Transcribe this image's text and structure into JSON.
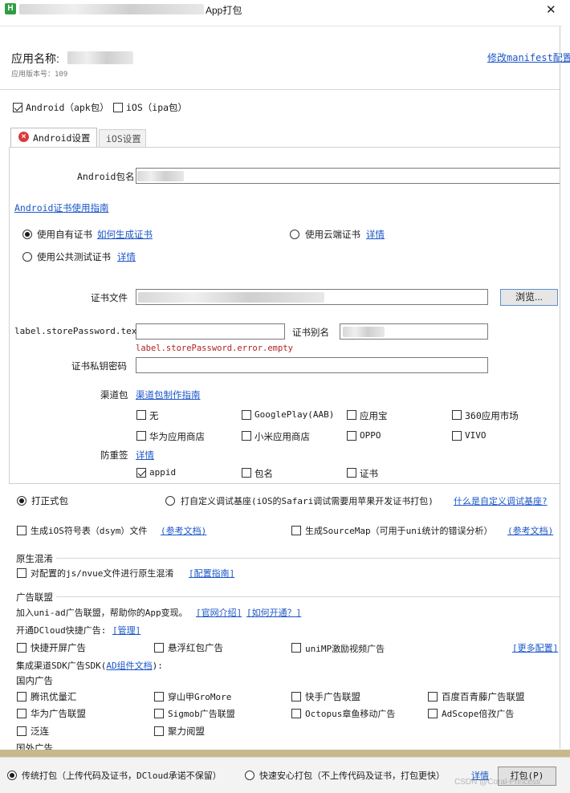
{
  "window": {
    "title": "App打包",
    "close_glyph": "✕",
    "logo_text": "H"
  },
  "header": {
    "app_name_label": "应用名称:",
    "app_version": "应用版本号：109",
    "manifest_link": "修改manifest配置"
  },
  "platforms": {
    "android": {
      "label": "Android（apk包）",
      "checked": true
    },
    "ios": {
      "label": "iOS（ipa包）",
      "checked": false
    }
  },
  "tabs": [
    {
      "label": "Android设置",
      "active": true,
      "error": true
    },
    {
      "label": "iOS设置",
      "active": false
    }
  ],
  "android": {
    "package_label": "Android包名",
    "cert_guide_link": "Android证书使用指南",
    "cert_options": {
      "own": {
        "label": "使用自有证书",
        "link": "如何生成证书",
        "checked": true
      },
      "cloud": {
        "label": "使用云端证书",
        "link": "详情",
        "checked": false
      },
      "public": {
        "label": "使用公共测试证书",
        "link": "详情",
        "checked": false
      }
    },
    "cert_file_label": "证书文件",
    "browse_button": "浏览...",
    "store_password_label": "label.storePassword.text",
    "alias_label": "证书别名",
    "store_password_error": "label.storePassword.error.empty",
    "key_password_label": "证书私钥密码",
    "channel_label": "渠道包",
    "channel_link": "渠道包制作指南",
    "channels": [
      {
        "label": "无",
        "checked": false
      },
      {
        "label": "GooglePlay(AAB)",
        "checked": false
      },
      {
        "label": "应用宝",
        "checked": false
      },
      {
        "label": "360应用市场",
        "checked": false
      },
      {
        "label": "华为应用商店",
        "checked": false
      },
      {
        "label": "小米应用商店",
        "checked": false
      },
      {
        "label": "OPPO",
        "checked": false
      },
      {
        "label": "VIVO",
        "checked": false
      }
    ],
    "anti_label": "防重签",
    "anti_link": "详情",
    "anti_options": [
      {
        "label": "appid",
        "checked": true
      },
      {
        "label": "包名",
        "checked": false
      },
      {
        "label": "证书",
        "checked": false
      }
    ]
  },
  "build_type": {
    "formal": {
      "label": "打正式包",
      "checked": true
    },
    "custom": {
      "label": "打自定义调试基座(iOS的Safari调试需要用苹果开发证书打包)",
      "checked": false
    },
    "custom_link": "什么是自定义调试基座?"
  },
  "symbols": {
    "ios_dsym": {
      "label": "生成iOS符号表（dsym）文件",
      "checked": false
    },
    "ios_dsym_link": "(参考文档)",
    "sourcemap": {
      "label": "生成SourceMap（可用于uni统计的错误分析）",
      "checked": false
    },
    "sourcemap_link": "(参考文档)"
  },
  "obfuscation": {
    "title": "原生混淆",
    "checkbox": {
      "label": "对配置的js/nvue文件进行原生混淆",
      "checked": false
    },
    "link": "[配置指南]"
  },
  "ads": {
    "title": "广告联盟",
    "intro": "加入uni-ad广告联盟，帮助你的App变现。",
    "intro_link1": "[官网介绍]",
    "intro_link2": "[如何开通？]",
    "dcloud_label": "开通DCloud快捷广告:",
    "dcloud_link": "[管理]",
    "dcloud_items": [
      {
        "label": "快捷开屏广告",
        "checked": false
      },
      {
        "label": "悬浮红包广告",
        "checked": false
      },
      {
        "label": "uniMP激励视频广告",
        "checked": false
      }
    ],
    "more_link": "[更多配置]",
    "sdk_label_prefix": "集成渠道SDK广告SDK(",
    "sdk_link": "AD组件文档",
    "sdk_label_suffix": "):",
    "domestic_title": "国内广告",
    "domestic": [
      {
        "label": "腾讯优量汇",
        "checked": false
      },
      {
        "label": "穿山甲GroMore",
        "checked": false
      },
      {
        "label": "快手广告联盟",
        "checked": false
      },
      {
        "label": "百度百青藤广告联盟",
        "checked": false
      },
      {
        "label": "华为广告联盟",
        "checked": false
      },
      {
        "label": "Sigmob广告联盟",
        "checked": false
      },
      {
        "label": "Octopus章鱼移动广告",
        "checked": false
      },
      {
        "label": "AdScope倍孜广告",
        "checked": false
      },
      {
        "label": "泛连",
        "checked": false
      },
      {
        "label": "聚力阅盟",
        "checked": false
      }
    ],
    "foreign_title": "国外广告"
  },
  "footer": {
    "traditional": {
      "label": "传统打包（上传代码及证书，DCloud承诺不保留）",
      "checked": true
    },
    "fast": {
      "label": "快速安心打包（不上传代码及证书，打包更快）",
      "checked": false
    },
    "detail_link": "详情",
    "build_button": "打包(P)",
    "watermark": "CSDN @Coral-Princess"
  },
  "colors": {
    "link": "#1a55c8",
    "error_text": "#b22222",
    "footer_stripe": "#c8b98a"
  }
}
